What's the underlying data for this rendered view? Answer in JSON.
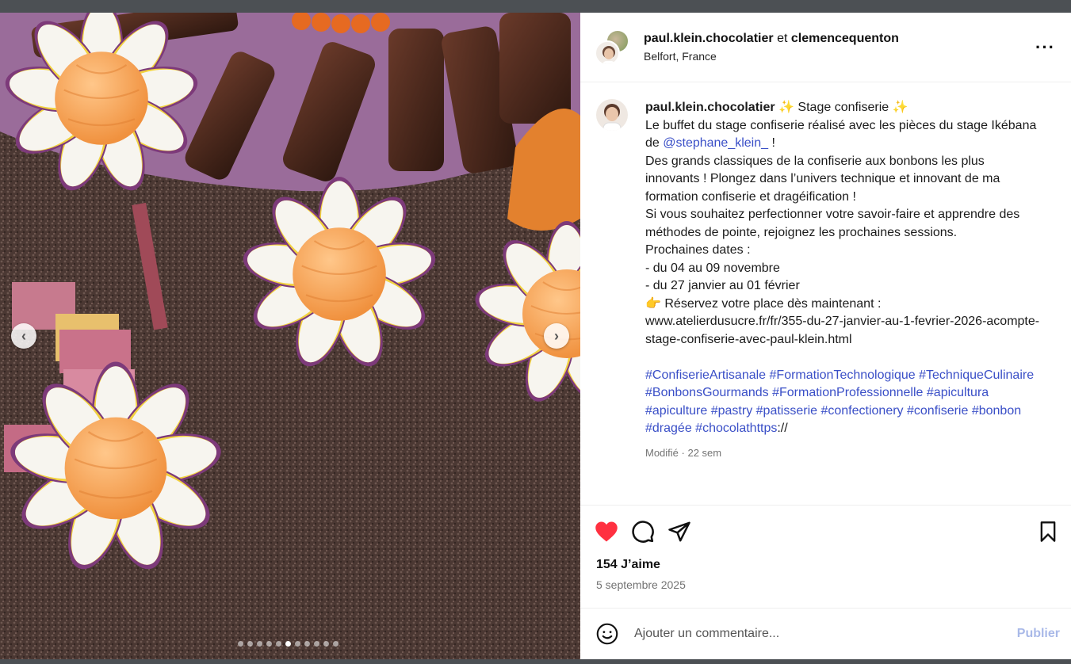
{
  "header": {
    "author": "paul.klein.chocolatier",
    "joiner": "et",
    "coauthor": "clemencequenton",
    "location": "Belfort, France",
    "more_icon": "more-horizontal-icon"
  },
  "caption": {
    "author": "paul.klein.chocolatier",
    "title": "✨ Stage confiserie ✨",
    "line1": "Le buffet du stage confiserie réalisé avec les pièces du stage Ikébana de",
    "mention": "@stephane_klein_",
    "line1_end": " !",
    "line2": "Des grands classiques de la confiserie aux bonbons les plus innovants ! Plongez dans l’univers technique et innovant de ma formation confiserie et dragéification !",
    "line3": "Si vous souhaitez perfectionner votre savoir-faire et apprendre des méthodes de pointe, rejoignez les prochaines sessions.",
    "dates_title": "Prochaines dates :",
    "date1": "- du 04 au 09 novembre",
    "date2": "- du 27 janvier au 01 février",
    "reserve": "👉 Réservez votre place dès maintenant :",
    "url": "www.atelierdusucre.fr/fr/355-du-27-janvier-au-1-fevrier-2026-acompte-stage-confiserie-avec-paul-klein.html",
    "hashtags": [
      "#ConfiserieArtisanale",
      "#FormationTechnologique",
      "#TechniqueCulinaire",
      "#BonbonsGourmands",
      "#FormationProfessionnelle",
      "#apicultura",
      "#apiculture",
      "#pastry",
      "#patisserie",
      "#confectionery",
      "#confiserie",
      "#bonbon",
      "#dragée",
      "#chocolathttps"
    ],
    "hashtag_tail": "://",
    "meta": "Modifié · 22 sem"
  },
  "actions": {
    "like_icon": "heart-filled-icon",
    "comment_icon": "comment-icon",
    "share_icon": "send-icon",
    "save_icon": "bookmark-icon",
    "like_color": "#ff3040"
  },
  "likes": "154 J’aime",
  "date": "5 septembre 2025",
  "comment_box": {
    "emoji_icon": "smiley-icon",
    "placeholder": "Ajouter un commentaire...",
    "post_label": "Publier"
  },
  "carousel": {
    "total": 11,
    "active_index": 4,
    "prev_icon": "chevron-left-icon",
    "next_icon": "chevron-right-icon"
  }
}
